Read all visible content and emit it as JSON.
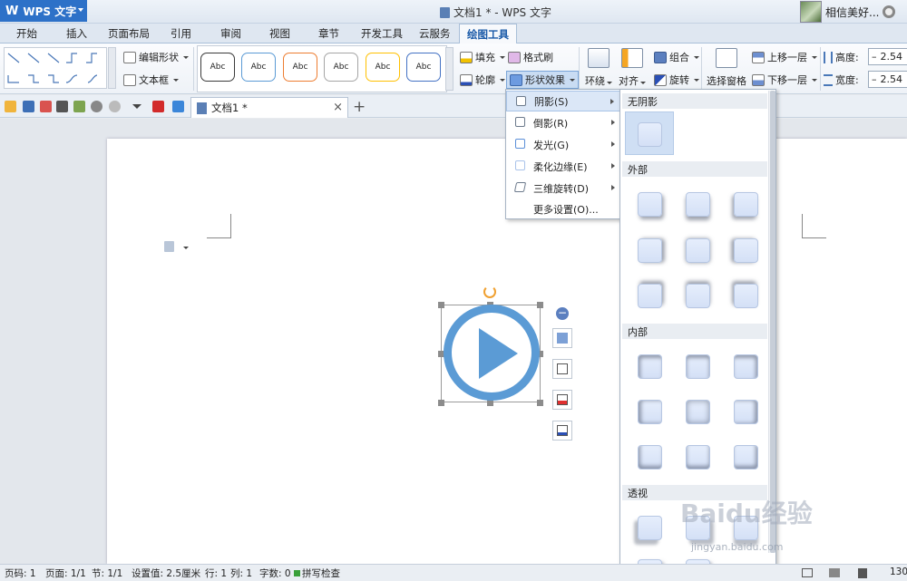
{
  "app": {
    "name": "WPS 文字",
    "window_title": "文档1 * - WPS 文字",
    "user_name": "相信美好..."
  },
  "tabs": [
    "开始",
    "插入",
    "页面布局",
    "引用",
    "审阅",
    "视图",
    "章节",
    "开发工具",
    "云服务",
    "绘图工具"
  ],
  "active_tab": "绘图工具",
  "ribbon": {
    "edit_shape": "编辑形状",
    "text_box": "文本框",
    "style_labels": [
      "Abc",
      "Abc",
      "Abc",
      "Abc",
      "Abc",
      "Abc"
    ],
    "style_colors": [
      "#3a3a3a",
      "#5b9bd5",
      "#ed7d31",
      "#a5a5a5",
      "#ffc000",
      "#4472c4"
    ],
    "fill": "填充",
    "format_painter": "格式刷",
    "outline": "轮廓",
    "shape_effect": "形状效果",
    "wrap": "环绕",
    "align": "对齐",
    "group": "组合",
    "rotate": "旋转",
    "selection_pane": "选择窗格",
    "bring_forward": "上移一层",
    "send_backward": "下移一层",
    "height_label": "高度:",
    "width_label": "宽度:",
    "height_value": "2.54",
    "width_value": "2.54"
  },
  "document_tab": {
    "title": "文档1 *"
  },
  "effect_menu": [
    {
      "label": "阴影(S)",
      "highlighted": true
    },
    {
      "label": "倒影(R)",
      "highlighted": false
    },
    {
      "label": "发光(G)",
      "highlighted": false
    },
    {
      "label": "柔化边缘(E)",
      "highlighted": false
    },
    {
      "label": "三维旋转(D)",
      "highlighted": false
    },
    {
      "label": "更多设置(O)...",
      "highlighted": false
    }
  ],
  "shadow_gallery": {
    "sections": [
      "无阴影",
      "外部",
      "内部",
      "透视"
    ]
  },
  "watermark": {
    "text": "Baidu经验",
    "url": "jingyan.baidu.com"
  },
  "status_bar": {
    "page_num": "页码: 1",
    "pages": "页面: 1/1",
    "section": "节: 1/1",
    "setting": "设置值: 2.5厘米",
    "row": "行: 1",
    "col": "列: 1",
    "word_count": "字数: 0",
    "spell_check": "拼写检查",
    "zoom": "130"
  }
}
